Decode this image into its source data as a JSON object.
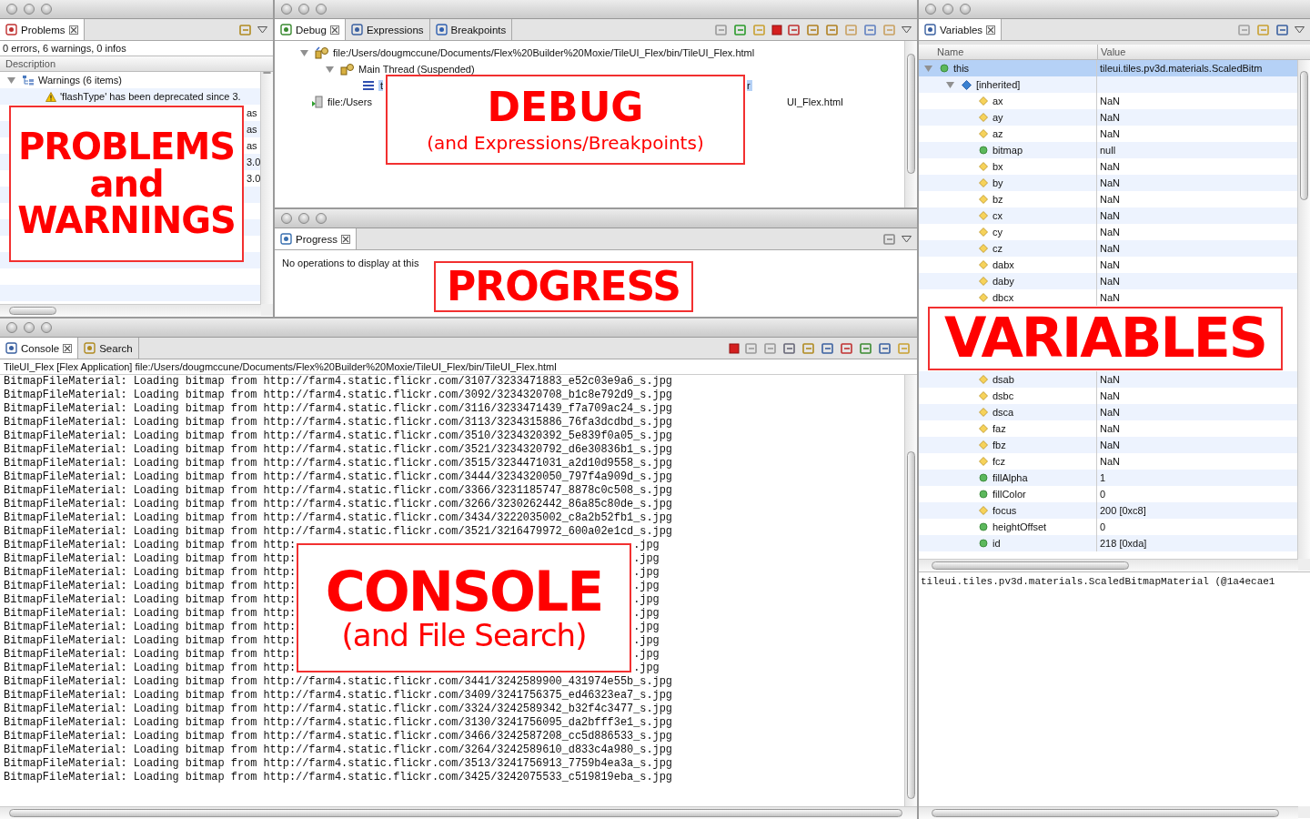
{
  "problems": {
    "tab": {
      "label": "Problems",
      "selected": true
    },
    "summary": "0 errors, 6 warnings, 0 infos",
    "columns": [
      "Description"
    ],
    "tree": [
      {
        "label": "Warnings (6 items)",
        "expanded": true,
        "children": [
          {
            "label": "'flashType' has been deprecated since 3."
          },
          {
            "tail": "as"
          },
          {
            "tail": "as"
          },
          {
            "tail": "as"
          },
          {
            "tail": "3.0"
          },
          {
            "tail": "3.0"
          }
        ]
      }
    ],
    "callout": {
      "lines": [
        {
          "text": "PROBLEMS",
          "kind": "title"
        },
        {
          "text": "and",
          "kind": "title"
        },
        {
          "text": "WARNINGS",
          "kind": "title"
        }
      ]
    }
  },
  "debug": {
    "tabs": [
      {
        "label": "Debug",
        "selected": true
      },
      {
        "label": "Expressions",
        "selected": false
      },
      {
        "label": "Breakpoints",
        "selected": false
      }
    ],
    "tree": [
      {
        "label": "file:/Users/dougmccune/Documents/Flex%20Builder%20Moxie/TileUI_Flex/bin/TileUI_Flex.html",
        "kind": "launch",
        "selected": false,
        "expanded": true,
        "children": [
          {
            "label": "Main Thread (Suspended)",
            "kind": "thread",
            "selected": false,
            "expanded": true,
            "children": [
              {
                "label": "t",
                "tail": "r",
                "kind": "frame",
                "selected": true
              }
            ]
          }
        ]
      },
      {
        "label": "file:/Users",
        "tail": "UI_Flex.html",
        "kind": "process",
        "selected": false
      }
    ],
    "callout": {
      "lines": [
        {
          "text": "DEBUG",
          "kind": "title"
        },
        {
          "text": "(and Expressions/Breakpoints)",
          "kind": "subtitle"
        }
      ]
    }
  },
  "progress": {
    "tab": {
      "label": "Progress",
      "selected": true
    },
    "message": "No operations to display at this",
    "callout": {
      "lines": [
        {
          "text": "PROGRESS",
          "kind": "title"
        }
      ]
    }
  },
  "console": {
    "tabs": [
      {
        "label": "Console",
        "selected": true
      },
      {
        "label": "Search",
        "selected": false
      }
    ],
    "header": "TileUI_Flex [Flex Application] file:/Users/dougmccune/Documents/Flex%20Builder%20Moxie/TileUI_Flex/bin/TileUI_Flex.html",
    "lines": [
      {
        "text": "BitmapFileMaterial: Loading bitmap from http://farm4.static.flickr.com/3107/3233471883_e52c03e9a6_s.jpg"
      },
      {
        "text": "BitmapFileMaterial: Loading bitmap from http://farm4.static.flickr.com/3092/3234320708_b1c8e792d9_s.jpg"
      },
      {
        "text": "BitmapFileMaterial: Loading bitmap from http://farm4.static.flickr.com/3116/3233471439_f7a709ac24_s.jpg"
      },
      {
        "text": "BitmapFileMaterial: Loading bitmap from http://farm4.static.flickr.com/3113/3234315886_76fa3dcdbd_s.jpg"
      },
      {
        "text": "BitmapFileMaterial: Loading bitmap from http://farm4.static.flickr.com/3510/3234320392_5e839f0a05_s.jpg"
      },
      {
        "text": "BitmapFileMaterial: Loading bitmap from http://farm4.static.flickr.com/3521/3234320792_d6e30836b1_s.jpg"
      },
      {
        "text": "BitmapFileMaterial: Loading bitmap from http://farm4.static.flickr.com/3515/3234471031_a2d10d9558_s.jpg"
      },
      {
        "text": "BitmapFileMaterial: Loading bitmap from http://farm4.static.flickr.com/3444/3234320050_797f4a909d_s.jpg"
      },
      {
        "text": "BitmapFileMaterial: Loading bitmap from http://farm4.static.flickr.com/3366/3231185747_8878c0c508_s.jpg"
      },
      {
        "text": "BitmapFileMaterial: Loading bitmap from http://farm4.static.flickr.com/3266/3230262442_86a85c80de_s.jpg"
      },
      {
        "text": "BitmapFileMaterial: Loading bitmap from http://farm4.static.flickr.com/3434/3222035002_c8a2b52fb1_s.jpg"
      },
      {
        "text": "BitmapFileMaterial: Loading bitmap from http://farm4.static.flickr.com/3521/3216479972_600a02e1cd_s.jpg"
      },
      {
        "text": "BitmapFileMaterial: Loading bitmap from http:",
        "tail": ".jpg"
      },
      {
        "text": "BitmapFileMaterial: Loading bitmap from http:",
        "tail": ".jpg"
      },
      {
        "text": "BitmapFileMaterial: Loading bitmap from http:",
        "tail": ".jpg"
      },
      {
        "text": "BitmapFileMaterial: Loading bitmap from http:",
        "tail": ".jpg"
      },
      {
        "text": "BitmapFileMaterial: Loading bitmap from http:",
        "tail": ".jpg"
      },
      {
        "text": "BitmapFileMaterial: Loading bitmap from http:",
        "tail": ".jpg"
      },
      {
        "text": "BitmapFileMaterial: Loading bitmap from http:",
        "tail": ".jpg"
      },
      {
        "text": "BitmapFileMaterial: Loading bitmap from http:",
        "tail": ".jpg"
      },
      {
        "text": "BitmapFileMaterial: Loading bitmap from http:",
        "tail": ".jpg"
      },
      {
        "text": "BitmapFileMaterial: Loading bitmap from http:",
        "tail": ".jpg"
      },
      {
        "text": "BitmapFileMaterial: Loading bitmap from http://farm4.static.flickr.com/3441/3242589900_431974e55b_s.jpg"
      },
      {
        "text": "BitmapFileMaterial: Loading bitmap from http://farm4.static.flickr.com/3409/3241756375_ed46323ea7_s.jpg"
      },
      {
        "text": "BitmapFileMaterial: Loading bitmap from http://farm4.static.flickr.com/3324/3242589342_b32f4c3477_s.jpg"
      },
      {
        "text": "BitmapFileMaterial: Loading bitmap from http://farm4.static.flickr.com/3130/3241756095_da2bfff3e1_s.jpg"
      },
      {
        "text": "BitmapFileMaterial: Loading bitmap from http://farm4.static.flickr.com/3466/3242587208_cc5d886533_s.jpg"
      },
      {
        "text": "BitmapFileMaterial: Loading bitmap from http://farm4.static.flickr.com/3264/3242589610_d833c4a980_s.jpg"
      },
      {
        "text": "BitmapFileMaterial: Loading bitmap from http://farm4.static.flickr.com/3513/3241756913_7759b4ea3a_s.jpg"
      },
      {
        "text": "BitmapFileMaterial: Loading bitmap from http://farm4.static.flickr.com/3425/3242075533_c519819eba_s.jpg"
      }
    ],
    "callout": {
      "lines": [
        {
          "text": "CONSOLE",
          "kind": "title"
        },
        {
          "text": "(and File Search)",
          "kind": "subtitle"
        }
      ]
    }
  },
  "variables": {
    "tab": {
      "label": "Variables",
      "selected": true
    },
    "columns": [
      "Name",
      "Value"
    ],
    "tree": [
      {
        "name": "this",
        "value": "tileui.tiles.pv3d.materials.ScaledBitm",
        "kind": "property",
        "selected": true,
        "expanded": true,
        "children": [
          {
            "name": "[inherited]",
            "kind": "inherited",
            "selected": false,
            "expanded": true,
            "children": [
              {
                "name": "ax",
                "value": "NaN",
                "kind": "field",
                "selected": false
              },
              {
                "name": "ay",
                "value": "NaN",
                "kind": "field",
                "selected": false
              },
              {
                "name": "az",
                "value": "NaN",
                "kind": "field",
                "selected": false
              },
              {
                "name": "bitmap",
                "value": "null",
                "kind": "property",
                "selected": false
              },
              {
                "name": "bx",
                "value": "NaN",
                "kind": "field",
                "selected": false
              },
              {
                "name": "by",
                "value": "NaN",
                "kind": "field",
                "selected": false
              },
              {
                "name": "bz",
                "value": "NaN",
                "kind": "field",
                "selected": false
              },
              {
                "name": "cx",
                "value": "NaN",
                "kind": "field",
                "selected": false
              },
              {
                "name": "cy",
                "value": "NaN",
                "kind": "field",
                "selected": false
              },
              {
                "name": "cz",
                "value": "NaN",
                "kind": "field",
                "selected": false
              },
              {
                "name": "dabx",
                "value": "NaN",
                "kind": "field",
                "selected": false
              },
              {
                "name": "daby",
                "value": "NaN",
                "kind": "field",
                "selected": false
              },
              {
                "name": "dbcx",
                "value": "NaN",
                "kind": "field",
                "selected": false
              },
              {
                "kind": "covered",
                "selected": false
              },
              {
                "kind": "covered",
                "selected": false
              },
              {
                "kind": "covered",
                "selected": false
              },
              {
                "kind": "covered",
                "selected": false
              },
              {
                "name": "dsab",
                "value": "NaN",
                "kind": "field",
                "selected": false
              },
              {
                "name": "dsbc",
                "value": "NaN",
                "kind": "field",
                "selected": false
              },
              {
                "name": "dsca",
                "value": "NaN",
                "kind": "field",
                "selected": false
              },
              {
                "name": "faz",
                "value": "NaN",
                "kind": "field",
                "selected": false
              },
              {
                "name": "fbz",
                "value": "NaN",
                "kind": "field",
                "selected": false
              },
              {
                "name": "fcz",
                "value": "NaN",
                "kind": "field",
                "selected": false
              },
              {
                "name": "fillAlpha",
                "value": "1",
                "kind": "property",
                "selected": false
              },
              {
                "name": "fillColor",
                "value": "0",
                "kind": "property",
                "selected": false
              },
              {
                "name": "focus",
                "value": "200 [0xc8]",
                "kind": "field",
                "selected": false
              },
              {
                "name": "heightOffset",
                "value": "0",
                "kind": "property",
                "selected": false
              },
              {
                "name": "id",
                "value": "218 [0xda]",
                "kind": "property",
                "selected": false
              }
            ]
          }
        ]
      }
    ],
    "detail": "tileui.tiles.pv3d.materials.ScaledBitmapMaterial (@1a4ecae1",
    "callout": {
      "lines": [
        {
          "text": "VARIABLES",
          "kind": "title"
        }
      ]
    }
  }
}
